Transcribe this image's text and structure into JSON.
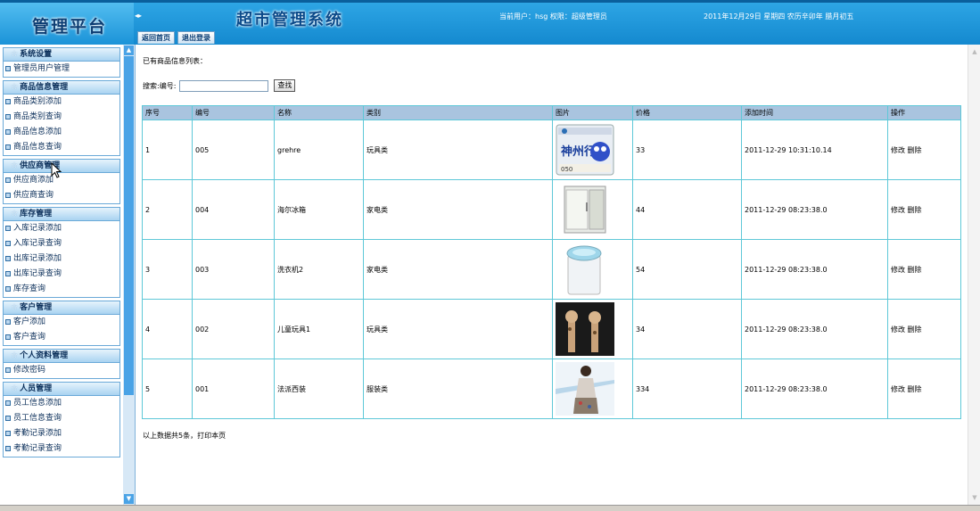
{
  "header": {
    "logo_text": "管理平台",
    "system_title": "超市管理系统",
    "user_info": "当前用户：hsg 权限：超级管理员",
    "date_info": "2011年12月29日 星期四 农历辛卯年 腊月初五",
    "nav_buttons": [
      "返回首页",
      "退出登录"
    ]
  },
  "sidebar": {
    "groups": [
      {
        "title": "系统设置",
        "items": [
          "管理员用户管理"
        ]
      },
      {
        "title": "商品信息管理",
        "items": [
          "商品类别添加",
          "商品类别查询",
          "商品信息添加",
          "商品信息查询"
        ]
      },
      {
        "title": "供应商管理",
        "items": [
          "供应商添加",
          "供应商查询"
        ]
      },
      {
        "title": "库存管理",
        "items": [
          "入库记录添加",
          "入库记录查询",
          "出库记录添加",
          "出库记录查询",
          "库存查询"
        ]
      },
      {
        "title": "客户管理",
        "items": [
          "客户添加",
          "客户查询"
        ]
      },
      {
        "title": "个人资料管理",
        "items": [
          "修改密码"
        ]
      },
      {
        "title": "人员管理",
        "items": [
          "员工信息添加",
          "员工信息查询",
          "考勤记录添加",
          "考勤记录查询"
        ]
      }
    ]
  },
  "main": {
    "list_title": "已有商品信息列表：",
    "search_label": "搜索:编号:",
    "search_value": "",
    "search_button": "查找",
    "table": {
      "headers": [
        "序号",
        "编号",
        "名称",
        "类别",
        "图片",
        "价格",
        "添加时间",
        "操作"
      ],
      "rows": [
        {
          "seq": "1",
          "code": "005",
          "name": "grehre",
          "category": "玩具类",
          "image": "prepaid-card-image",
          "price": "33",
          "time": "2011-12-29 10:31:10.14",
          "edit": "修改",
          "delete": "删除"
        },
        {
          "seq": "2",
          "code": "004",
          "name": "海尔冰箱",
          "category": "家电类",
          "image": "refrigerator-image",
          "price": "44",
          "time": "2011-12-29 08:23:38.0",
          "edit": "修改",
          "delete": "删除"
        },
        {
          "seq": "3",
          "code": "003",
          "name": "洗衣机2",
          "category": "家电类",
          "image": "washing-machine-image",
          "price": "54",
          "time": "2011-12-29 08:23:38.0",
          "edit": "修改",
          "delete": "删除"
        },
        {
          "seq": "4",
          "code": "002",
          "name": "儿童玩具1",
          "category": "玩具类",
          "image": "toy-giraffes-image",
          "price": "34",
          "time": "2011-12-29 08:23:38.0",
          "edit": "修改",
          "delete": "删除"
        },
        {
          "seq": "5",
          "code": "001",
          "name": "法派西装",
          "category": "服装类",
          "image": "dress-model-image",
          "price": "334",
          "time": "2011-12-29 08:23:38.0",
          "edit": "修改",
          "delete": "删除"
        }
      ]
    },
    "footer_text": "以上数据共5条，打印本页"
  },
  "colors": {
    "header_blue": "#1b93d8",
    "table_header_bg": "#a9c4df",
    "table_border": "#5ec8d8",
    "sidebar_head": "#a9d3f1"
  }
}
